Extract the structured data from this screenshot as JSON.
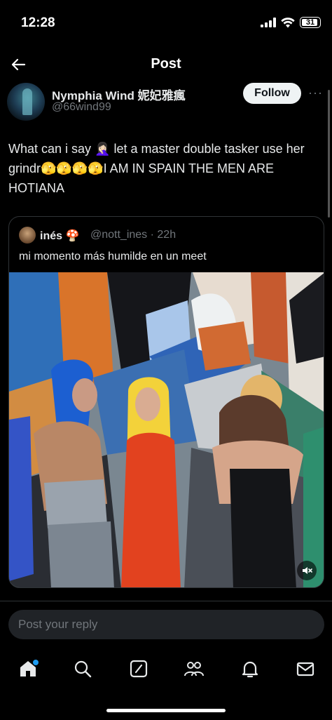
{
  "status_bar": {
    "time": "12:28",
    "battery": "31"
  },
  "header": {
    "title": "Post"
  },
  "post": {
    "author_name": "Nymphia Wind 妮妃雅瘋",
    "author_handle": "@66wind99",
    "follow_label": "Follow",
    "more_label": "···",
    "text": "What can i say 🤦🏻‍♀️ let a master double tasker use her grindr🫣🫣🫣🫣I AM IN SPAIN THE MEN ARE HOTIANA"
  },
  "quoted": {
    "author_name": "inés 🍄",
    "author_meta": "@nott_ines · 22h",
    "text": "mi momento más humilde en un meet"
  },
  "reply": {
    "placeholder": "Post your reply"
  },
  "tabs": [
    {
      "name": "home",
      "icon": "home-icon",
      "has_notification": true
    },
    {
      "name": "search",
      "icon": "search-icon"
    },
    {
      "name": "grok",
      "icon": "grok-icon"
    },
    {
      "name": "communities",
      "icon": "communities-icon"
    },
    {
      "name": "notifications",
      "icon": "bell-icon"
    },
    {
      "name": "messages",
      "icon": "mail-icon"
    }
  ],
  "colors": {
    "accent": "#1d9bf0",
    "background": "#000000",
    "text": "#e7e9ea",
    "muted": "#71767b"
  }
}
